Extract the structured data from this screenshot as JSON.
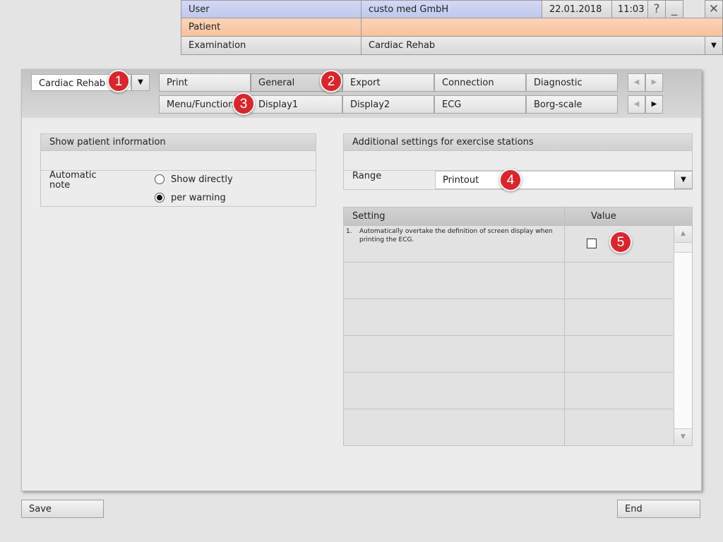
{
  "header": {
    "user_label": "User",
    "user_value": "custo med GmbH",
    "date": "22.01.2018",
    "time": "11:03",
    "patient_label": "Patient",
    "patient_value": "",
    "exam_label": "Examination",
    "exam_value": "Cardiac Rehab",
    "help_glyph": "?",
    "minimize_glyph": "_",
    "close_glyph": "✕",
    "dropdown_glyph": "▼"
  },
  "profile": {
    "value": "Cardiac Rehab",
    "arrow": "▼"
  },
  "tabs_row1": [
    "Print",
    "General",
    "Export",
    "Connection",
    "Diagnostic"
  ],
  "tabs_row2": [
    "Menu/Functions",
    "Display1",
    "Display2",
    "ECG",
    "Borg-scale"
  ],
  "active_tab": "General",
  "nav": {
    "left": "◀",
    "right": "▶"
  },
  "badges": [
    "1",
    "2",
    "3",
    "4",
    "5"
  ],
  "patient_info": {
    "title": "Show patient information",
    "note_label": "Automatic\nnote",
    "options": [
      "Show directly",
      "per warning"
    ],
    "selected": "per warning"
  },
  "exercise": {
    "title": "Additional settings for exercise stations",
    "range_label": "Range",
    "range_value": "Printout",
    "col_setting": "Setting",
    "col_value": "Value",
    "rows": [
      {
        "num": "1.",
        "text": "Automatically overtake  the definition of screen display when printing the ECG.",
        "checked": false
      }
    ],
    "scroll_up": "▲",
    "scroll_down": "▼"
  },
  "footer": {
    "save": "Save",
    "end": "End"
  },
  "colors": {
    "user_row": "#c8d0f0",
    "patient_row": "#fbcbac",
    "badge": "#d7262e",
    "background": "#e4e4e4"
  }
}
